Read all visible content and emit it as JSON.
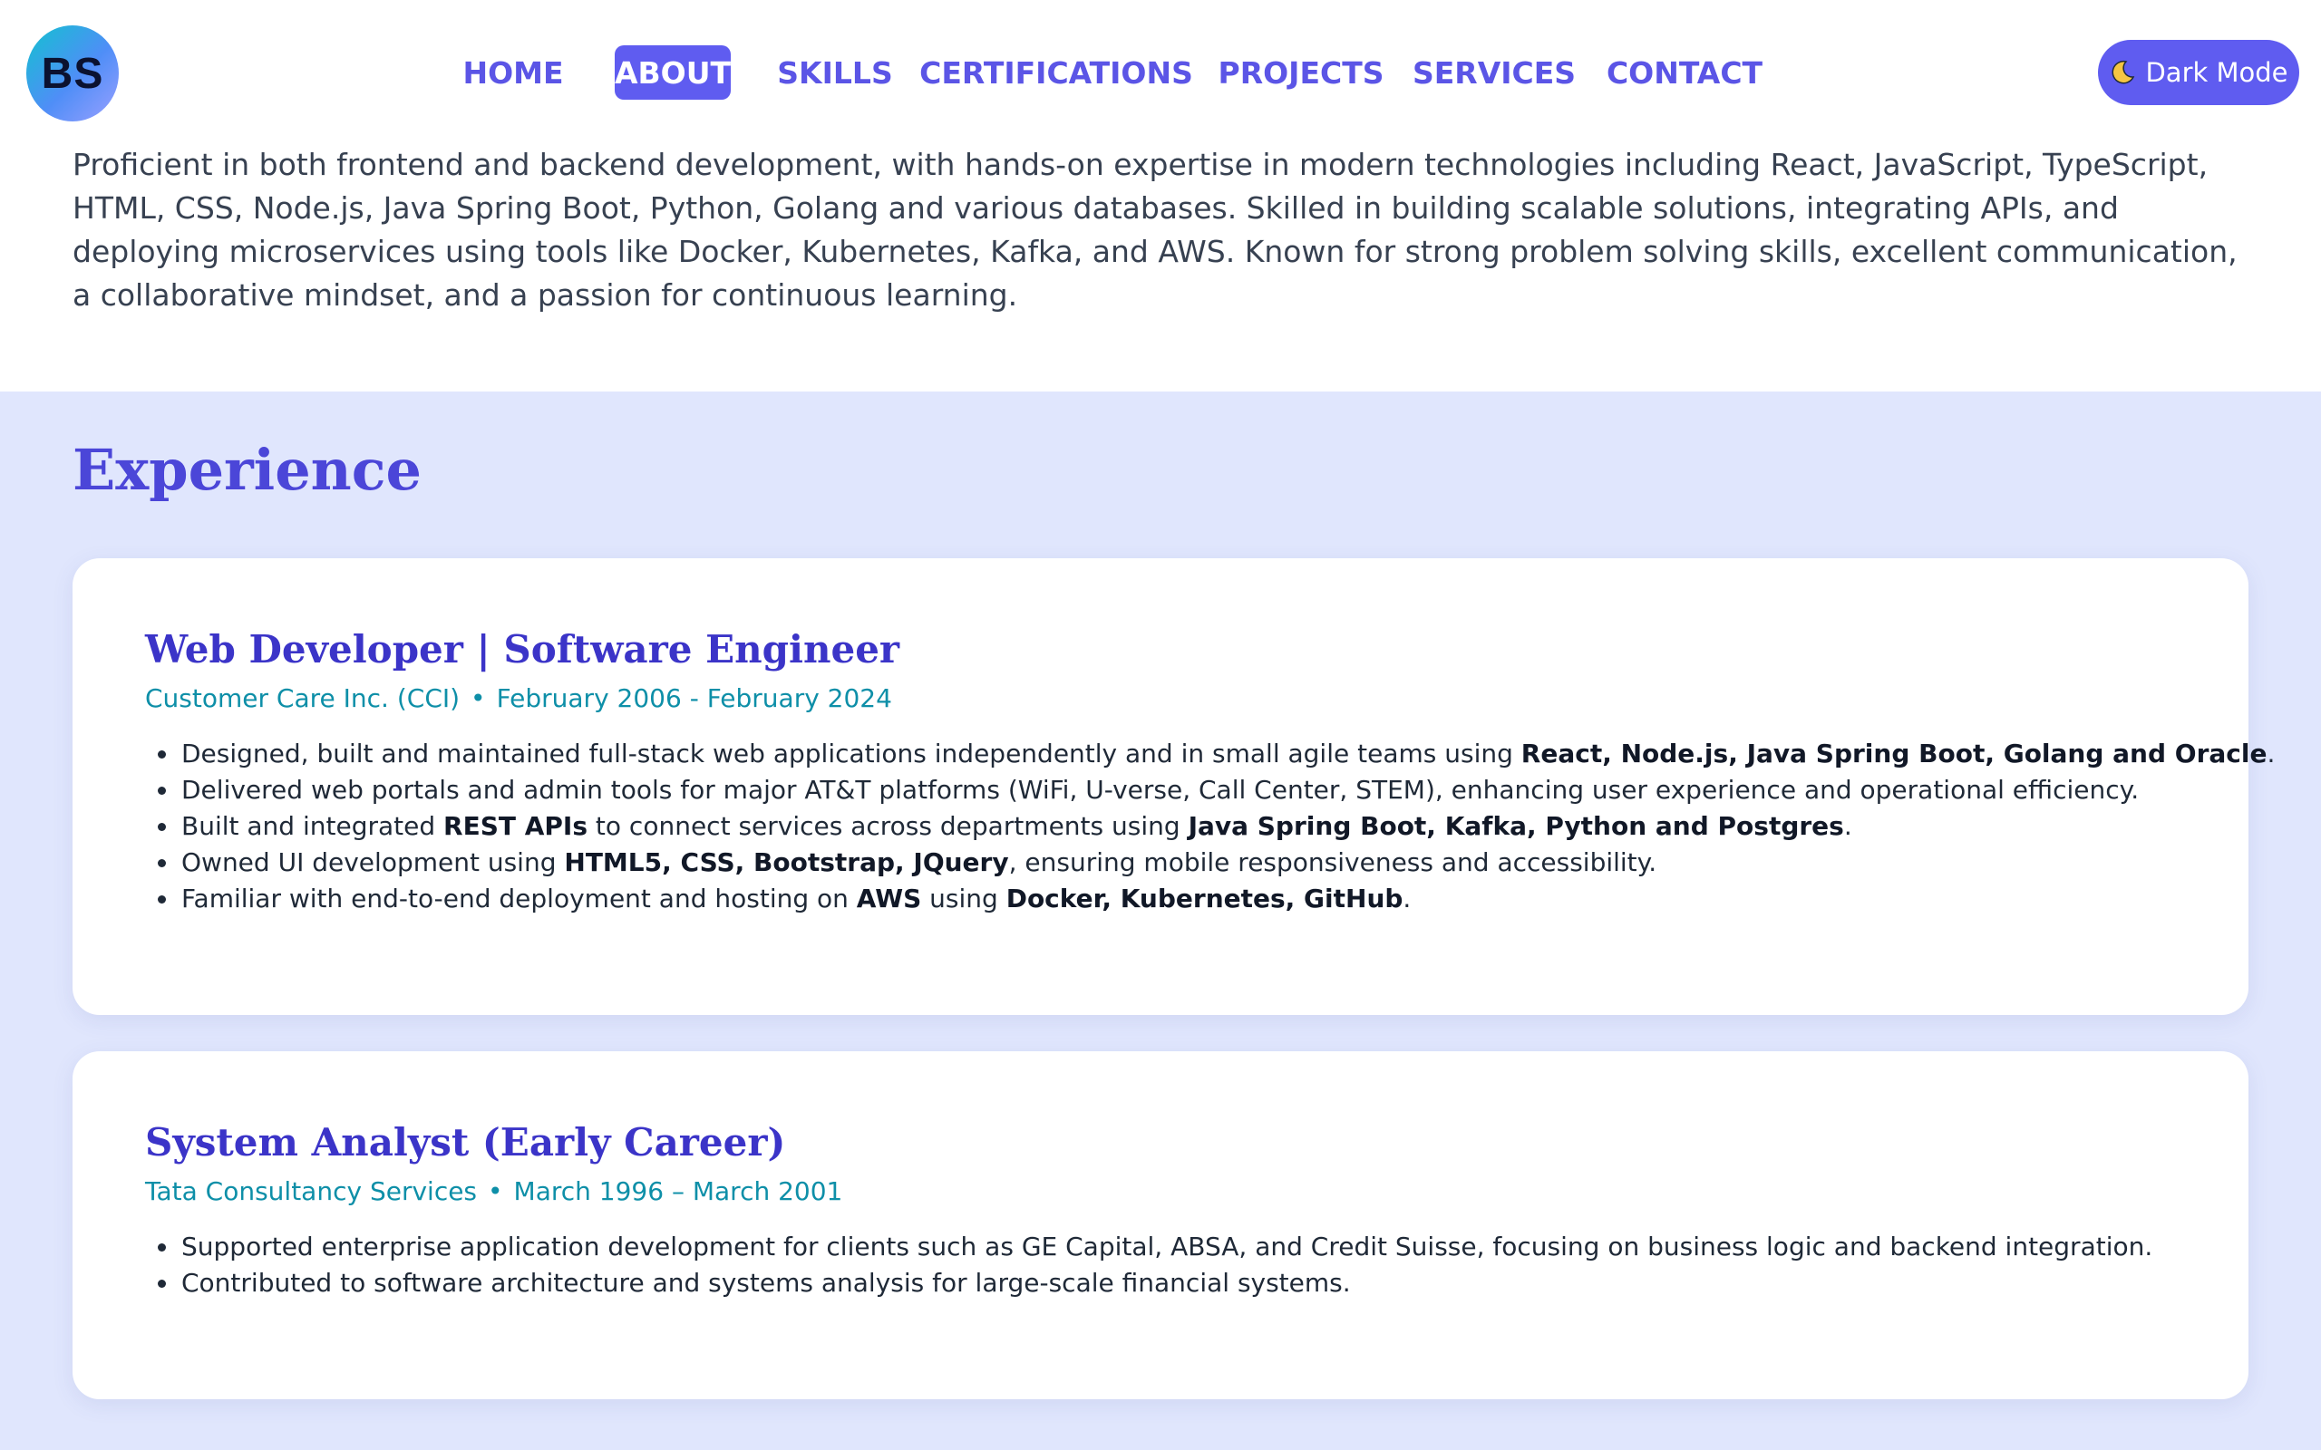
{
  "logo": {
    "initials": "BS"
  },
  "nav": {
    "items": [
      {
        "label": "HOME",
        "active": false
      },
      {
        "label": "ABOUT",
        "active": true
      },
      {
        "label": "SKILLS",
        "active": false
      },
      {
        "label": "CERTIFICATIONS",
        "active": false
      },
      {
        "label": "PROJECTS",
        "active": false
      },
      {
        "label": "SERVICES",
        "active": false
      },
      {
        "label": "CONTACT",
        "active": false
      }
    ],
    "dark_mode_label": "Dark Mode",
    "dark_mode_icon": "moon-icon"
  },
  "summary": {
    "text": "Proficient in both frontend and backend development, with hands-on expertise in modern technologies including React, JavaScript, TypeScript, HTML, CSS, Node.js, Java Spring Boot, Python, Golang and various databases. Skilled in building scalable solutions, integrating APIs, and deploying microservices using tools like Docker, Kubernetes, Kafka, and AWS. Known for strong problem solving skills, excellent communication, a collaborative mindset, and a passion for continuous learning."
  },
  "experience": {
    "heading": "Experience",
    "jobs": [
      {
        "title": "Web Developer | Software Engineer",
        "company": "Customer Care Inc. (CCI)",
        "separator": "•",
        "dates": "February 2006 - February 2024",
        "bullets": [
          {
            "pre": "Designed, built and maintained full-stack web applications independently and in small agile teams using ",
            "b1": "React, Node.js, Java Spring Boot, Golang and Oracle",
            "mid": ".",
            "b2": "",
            "post": ""
          },
          {
            "pre": "Delivered web portals and admin tools for major AT&T platforms (WiFi, U-verse, Call Center, STEM), enhancing user experience and operational efficiency.",
            "b1": "",
            "mid": "",
            "b2": "",
            "post": ""
          },
          {
            "pre": "Built and integrated ",
            "b1": "REST APIs",
            "mid": " to connect services across departments using ",
            "b2": "Java Spring Boot, Kafka, Python and Postgres",
            "post": "."
          },
          {
            "pre": "Owned UI development using ",
            "b1": "HTML5, CSS, Bootstrap, JQuery",
            "mid": ", ensuring mobile responsiveness and accessibility.",
            "b2": "",
            "post": ""
          },
          {
            "pre": "Familiar with end-to-end deployment and hosting on ",
            "b1": "AWS",
            "mid": " using ",
            "b2": "Docker, Kubernetes, GitHub",
            "post": "."
          }
        ]
      },
      {
        "title": "System Analyst (Early Career)",
        "company": "Tata Consultancy Services",
        "separator": "•",
        "dates": "March 1996 – March 2001",
        "bullets": [
          {
            "pre": "Supported enterprise application development for clients such as GE Capital, ABSA, and Credit Suisse, focusing on business logic and backend integration.",
            "b1": "",
            "mid": "",
            "b2": "",
            "post": ""
          },
          {
            "pre": "Contributed to software architecture and systems analysis for large-scale financial systems.",
            "b1": "",
            "mid": "",
            "b2": "",
            "post": ""
          }
        ]
      }
    ]
  },
  "colors": {
    "accent": "#5f5cf0",
    "heading": "#4b46d8",
    "job_title": "#3b34c8",
    "meta": "#0e8fa8",
    "section_bg": "#e0e6fd"
  }
}
